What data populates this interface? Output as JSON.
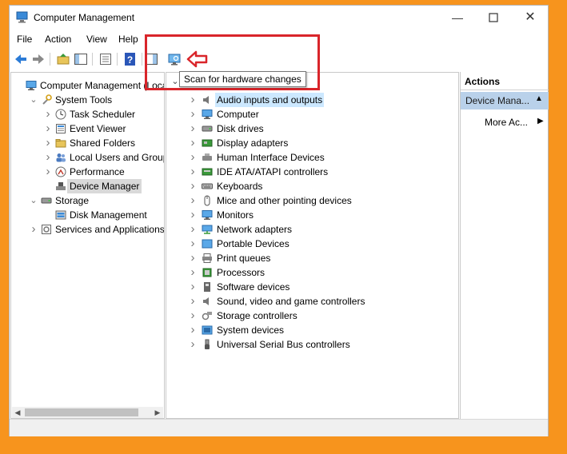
{
  "window": {
    "title": "Computer Management"
  },
  "menu": [
    "File",
    "Action",
    "View",
    "Help"
  ],
  "tooltip": "Scan for hardware changes",
  "left_tree": [
    {
      "label": "Computer Management (Local",
      "icon": "computer-management-icon",
      "expander": "none",
      "indent": 0
    },
    {
      "label": "System Tools",
      "icon": "system-tools-icon",
      "expander": "open",
      "indent": 1
    },
    {
      "label": "Task Scheduler",
      "icon": "task-scheduler-icon",
      "expander": "closed",
      "indent": 2
    },
    {
      "label": "Event Viewer",
      "icon": "event-viewer-icon",
      "expander": "closed",
      "indent": 2
    },
    {
      "label": "Shared Folders",
      "icon": "shared-folders-icon",
      "expander": "closed",
      "indent": 2
    },
    {
      "label": "Local Users and Groups",
      "icon": "local-users-icon",
      "expander": "closed",
      "indent": 2
    },
    {
      "label": "Performance",
      "icon": "performance-icon",
      "expander": "closed",
      "indent": 2
    },
    {
      "label": "Device Manager",
      "icon": "device-manager-icon",
      "expander": "none",
      "indent": 2,
      "selected": true
    },
    {
      "label": "Storage",
      "icon": "storage-icon",
      "expander": "open",
      "indent": 1
    },
    {
      "label": "Disk Management",
      "icon": "disk-management-icon",
      "expander": "none",
      "indent": 2
    },
    {
      "label": "Services and Applications",
      "icon": "services-icon",
      "expander": "closed",
      "indent": 1
    }
  ],
  "devices": [
    {
      "label": "Audio inputs and outputs",
      "icon": "audio-icon",
      "highlighted": true
    },
    {
      "label": "Computer",
      "icon": "computer-icon"
    },
    {
      "label": "Disk drives",
      "icon": "disk-drive-icon"
    },
    {
      "label": "Display adapters",
      "icon": "display-adapter-icon"
    },
    {
      "label": "Human Interface Devices",
      "icon": "hid-icon"
    },
    {
      "label": "IDE ATA/ATAPI controllers",
      "icon": "ide-controller-icon"
    },
    {
      "label": "Keyboards",
      "icon": "keyboard-icon"
    },
    {
      "label": "Mice and other pointing devices",
      "icon": "mouse-icon"
    },
    {
      "label": "Monitors",
      "icon": "monitor-icon"
    },
    {
      "label": "Network adapters",
      "icon": "network-adapter-icon"
    },
    {
      "label": "Portable Devices",
      "icon": "portable-device-icon"
    },
    {
      "label": "Print queues",
      "icon": "printer-icon"
    },
    {
      "label": "Processors",
      "icon": "processor-icon"
    },
    {
      "label": "Software devices",
      "icon": "software-device-icon"
    },
    {
      "label": "Sound, video and game controllers",
      "icon": "sound-icon"
    },
    {
      "label": "Storage controllers",
      "icon": "storage-controller-icon"
    },
    {
      "label": "System devices",
      "icon": "system-device-icon"
    },
    {
      "label": "Universal Serial Bus controllers",
      "icon": "usb-icon"
    }
  ],
  "actions": {
    "header": "Actions",
    "section": "Device Mana...",
    "more": "More Ac..."
  },
  "colors": {
    "frame": "#f7941d",
    "highlight_box": "#d9252a",
    "selection": "#cce8ff",
    "actions_section": "#b9d1ea"
  }
}
